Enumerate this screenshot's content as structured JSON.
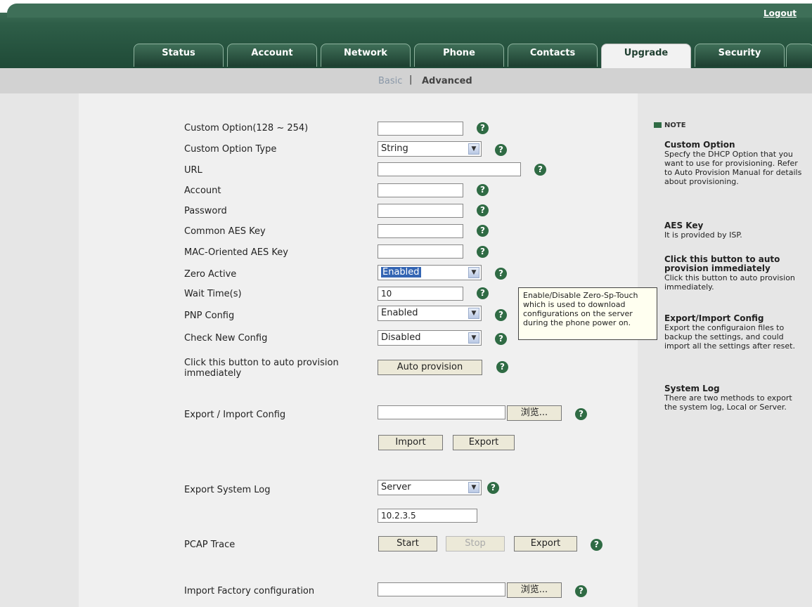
{
  "header": {
    "logout": "Logout"
  },
  "tabs": [
    "Status",
    "Account",
    "Network",
    "Phone",
    "Contacts",
    "Upgrade",
    "Security"
  ],
  "active_tab": "Upgrade",
  "subnav": {
    "basic": "Basic",
    "sep": "|",
    "advanced": "Advanced"
  },
  "form": {
    "custom_option": {
      "label": "Custom Option(128 ~ 254)",
      "value": ""
    },
    "custom_option_type": {
      "label": "Custom Option Type",
      "value": "String"
    },
    "url": {
      "label": "URL",
      "value": ""
    },
    "account": {
      "label": "Account",
      "value": ""
    },
    "password": {
      "label": "Password",
      "value": ""
    },
    "common_aes": {
      "label": "Common AES Key",
      "value": ""
    },
    "mac_aes": {
      "label": "MAC-Oriented AES Key",
      "value": ""
    },
    "zero_active": {
      "label": "Zero Active",
      "value": "Enabled"
    },
    "wait_time": {
      "label": "Wait Time(s)",
      "value": "10"
    },
    "pnp_config": {
      "label": "PNP Config",
      "value": "Enabled"
    },
    "check_new_config": {
      "label": "Check New Config",
      "value": "Disabled"
    },
    "auto_provision": {
      "label": "Click this button to auto provision immediately",
      "button": "Auto provision"
    },
    "export_import": {
      "label": "Export / Import Config",
      "browse": "浏览...",
      "import": "Import",
      "export": "Export"
    },
    "export_log": {
      "label": "Export System Log",
      "value": "Server",
      "server": "10.2.3.5"
    },
    "pcap": {
      "label": "PCAP Trace",
      "start": "Start",
      "stop": "Stop",
      "export": "Export"
    },
    "import_factory": {
      "label": "Import Factory configuration",
      "browse": "浏览..."
    }
  },
  "tooltip": "Enable/Disable Zero-Sp-Touch which is used to download configurations on the server during the phone power on.",
  "note": {
    "heading": "NOTE",
    "custom_option_title": "Custom Option",
    "custom_option_text": "Specfy the DHCP Option that you want to use for provisioning. Refer to Auto Provision Manual for details about provisioning.",
    "aes_title": "AES Key",
    "aes_text": "It is provided by ISP.",
    "auto_title": "Click this button to auto provision immediately",
    "auto_text": "Click this button to auto provision immediately.",
    "export_title": "Export/Import Config",
    "export_text": "Export the configuraion files to backup the settings, and could import all the settings after reset.",
    "syslog_title": "System Log",
    "syslog_text": "There are two methods to export the system log, Local or Server."
  }
}
